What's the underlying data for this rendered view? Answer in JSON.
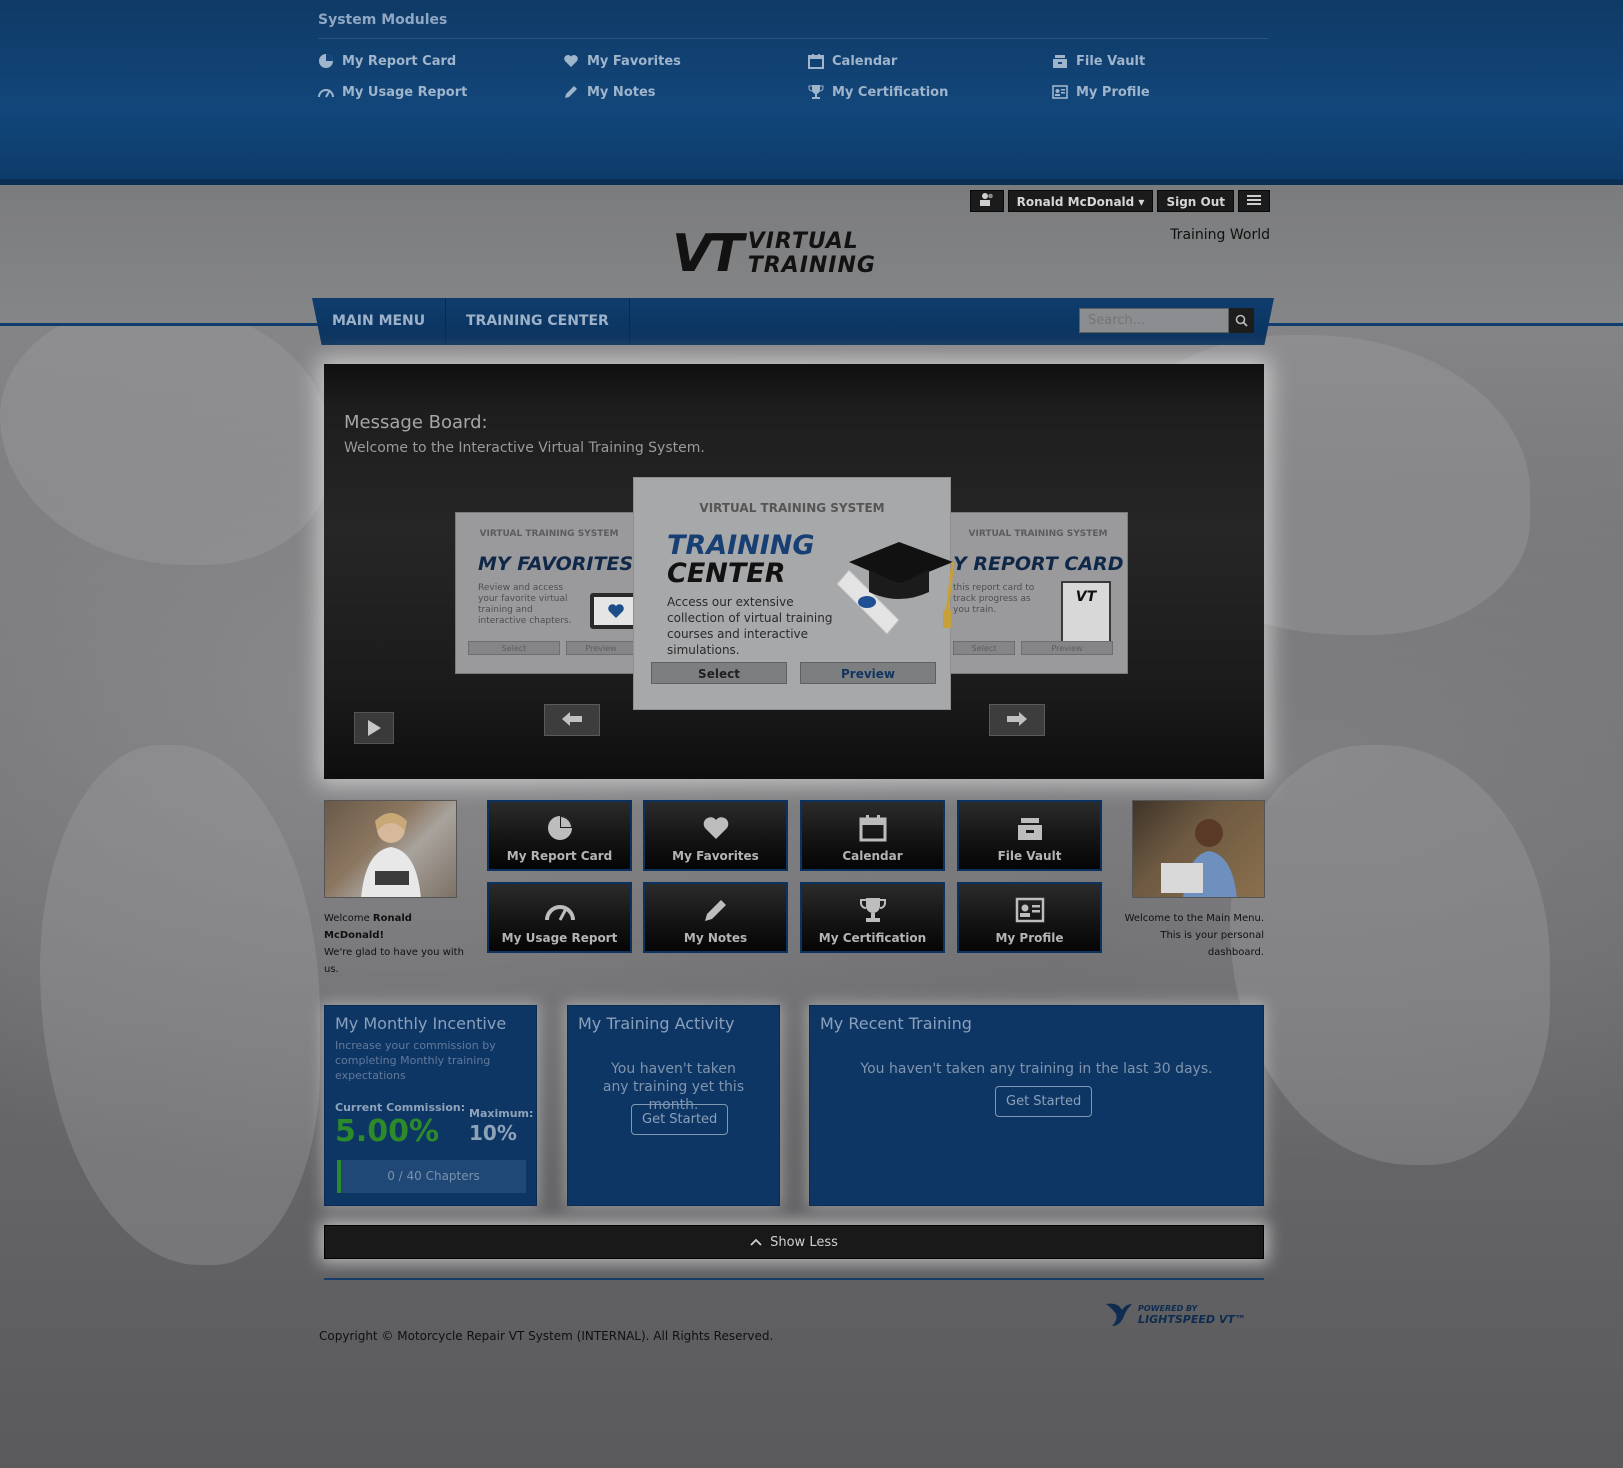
{
  "system_modules": {
    "title": "System Modules",
    "links": [
      {
        "label": "My Report Card",
        "icon": "pie-chart-icon"
      },
      {
        "label": "My Favorites",
        "icon": "heart-icon"
      },
      {
        "label": "Calendar",
        "icon": "calendar-icon"
      },
      {
        "label": "File Vault",
        "icon": "file-vault-icon"
      },
      {
        "label": "My Usage Report",
        "icon": "speedometer-icon"
      },
      {
        "label": "My Notes",
        "icon": "pencil-icon"
      },
      {
        "label": "My Certification",
        "icon": "trophy-icon"
      },
      {
        "label": "My Profile",
        "icon": "profile-card-icon"
      }
    ]
  },
  "userbar": {
    "user_name": "Ronald McDonald ▾",
    "sign_out": "Sign Out",
    "menu_icon": "hamburger-icon",
    "user_icon": "users-icon"
  },
  "header": {
    "logo_mark": "VT",
    "logo_line1": "VIRTUAL",
    "logo_line2": "TRAINING",
    "site_name": "Training World"
  },
  "nav": {
    "items": [
      "MAIN MENU",
      "TRAINING CENTER"
    ],
    "search_placeholder": "Search..."
  },
  "message_board": {
    "title": "Message Board:",
    "subtitle": "Welcome to the Interactive Virtual Training System.",
    "cards": {
      "left": {
        "header": "VIRTUAL TRAINING SYSTEM",
        "title": "MY FAVORITES",
        "desc": "Review and access your favorite virtual training and interactive chapters.",
        "select": "Select",
        "preview": "Preview"
      },
      "center": {
        "header": "VIRTUAL TRAINING SYSTEM",
        "title1": "TRAINING",
        "title2": "CENTER",
        "desc": "Access our extensive collection of virtual training courses and interactive simulations.",
        "select": "Select",
        "preview": "Preview"
      },
      "right": {
        "header": "VIRTUAL TRAINING SYSTEM",
        "title": "Y REPORT CARD",
        "desc": "this report card to track progress as you train.",
        "select": "Select",
        "preview": "Preview",
        "stamp": "VT"
      }
    }
  },
  "tiles": [
    {
      "label": "My Report Card",
      "icon": "pie-chart-icon"
    },
    {
      "label": "My Favorites",
      "icon": "heart-icon"
    },
    {
      "label": "Calendar",
      "icon": "calendar-icon"
    },
    {
      "label": "File Vault",
      "icon": "file-vault-icon"
    },
    {
      "label": "My Usage Report",
      "icon": "speedometer-icon"
    },
    {
      "label": "My Notes",
      "icon": "pencil-icon"
    },
    {
      "label": "My Certification",
      "icon": "trophy-icon"
    },
    {
      "label": "My Profile",
      "icon": "profile-card-icon"
    }
  ],
  "welcome_left": {
    "prefix": "Welcome ",
    "name": "Ronald McDonald",
    "suffix": "!",
    "line2": "We're glad to have you with us."
  },
  "welcome_right": {
    "text": "Welcome to the Main Menu. This is your personal dashboard."
  },
  "incentive": {
    "title": "My Monthly Incentive",
    "subtitle": "Increase your commission by completing Monthly training expectations",
    "current_label": "Current Commission:",
    "current_value": "5.00%",
    "max_label": "Maximum:",
    "max_value": "10%",
    "progress_text": "0 / 40 Chapters",
    "progress_fraction": 0
  },
  "training_activity": {
    "title": "My Training Activity",
    "text": "You haven't taken any training yet this month.",
    "button": "Get Started"
  },
  "recent_training": {
    "title": "My Recent Training",
    "text": "You haven't taken any training in the last 30 days.",
    "button": "Get Started"
  },
  "show_less": "Show Less",
  "footer": {
    "copyright": "Copyright © Motorcycle Repair VT System (INTERNAL). All Rights Reserved.",
    "powered_by_small": "POWERED BY",
    "powered_by_brand": "LIGHTSPEED VT™"
  },
  "colors": {
    "brand_blue": "#0e3665",
    "accent_green": "#2d8a2a"
  }
}
